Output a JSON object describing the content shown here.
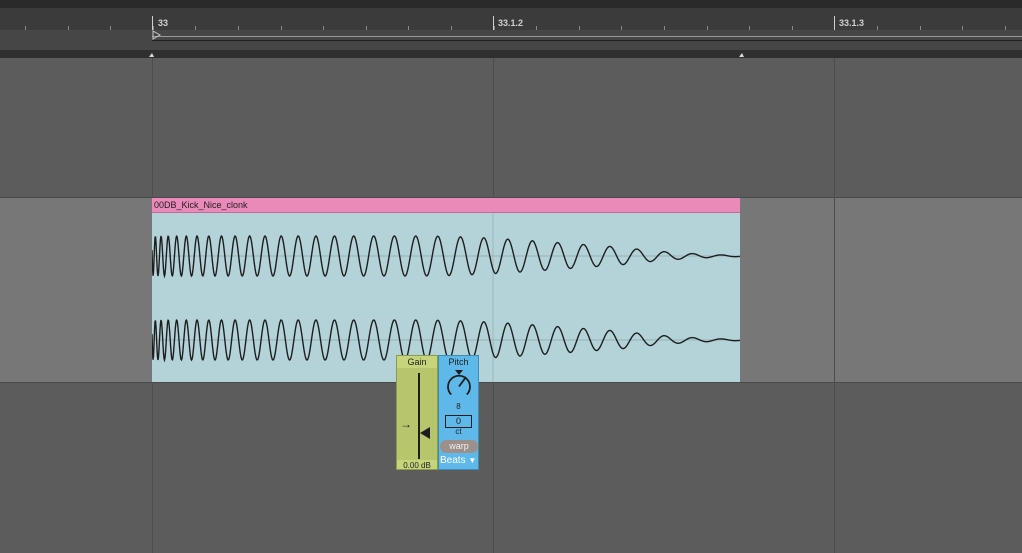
{
  "ruler": {
    "bars": [
      {
        "label": "33"
      },
      {
        "label": "33.1.2"
      },
      {
        "label": "33.1.3"
      }
    ]
  },
  "clip": {
    "name": "00DB_Kick_Nice_clonk",
    "header_color": "#e98ab9",
    "body_color": "#b4d3d8"
  },
  "gain": {
    "label": "Gain",
    "value": "0.00 dB",
    "color": "#c6d47c"
  },
  "pitch": {
    "label": "Pitch",
    "semitones": "8",
    "cents": "0",
    "cents_unit": "ct",
    "color": "#5fb8ea"
  },
  "warp": {
    "button_label": "warp",
    "mode": "Beats"
  },
  "icons": [
    "loop-start-marker-icon",
    "slider-pointer-icon",
    "chevron-down-icon",
    "pitch-knob-icon"
  ]
}
